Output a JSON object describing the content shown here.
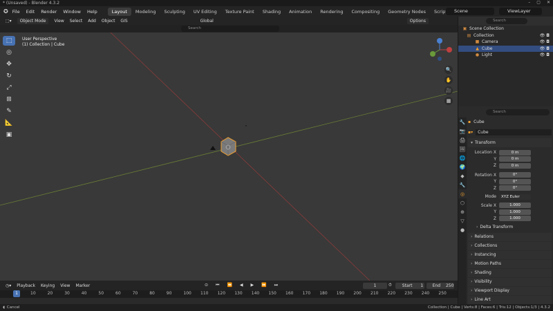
{
  "window": {
    "title": "* (Unsaved) - Blender 4.3.2",
    "buttons": [
      "–",
      "▢",
      "✕"
    ]
  },
  "menu": [
    "File",
    "Edit",
    "Render",
    "Window",
    "Help"
  ],
  "tabs": [
    "Layout",
    "Modeling",
    "Sculpting",
    "UV Editing",
    "Texture Paint",
    "Shading",
    "Animation",
    "Rendering",
    "Compositing",
    "Geometry Nodes",
    "Scripting"
  ],
  "active_tab": "Layout",
  "add_tab": "+",
  "scene": "Scene",
  "view_layer": "ViewLayer",
  "viewport_header": {
    "mode": "Object Mode",
    "menus": [
      "View",
      "Select",
      "Add",
      "Object",
      "GIS"
    ],
    "transform": "Global",
    "options": "Options"
  },
  "search": {
    "placeholder": "Search"
  },
  "viewport_info": {
    "line1": "User Perspective",
    "line2": "(1) Collection | Cube"
  },
  "outliner": {
    "search_placeholder": "Search",
    "rows": [
      {
        "label": "Scene Collection",
        "icon": "▣",
        "sel": false,
        "indent": 6
      },
      {
        "label": "Collection",
        "icon": "▤",
        "sel": false,
        "indent": 12
      },
      {
        "label": "Camera",
        "icon": "■",
        "sel": false,
        "indent": 24
      },
      {
        "label": "Cube",
        "icon": "▲",
        "sel": true,
        "indent": 24
      },
      {
        "label": "Light",
        "icon": "●",
        "sel": false,
        "indent": 24
      }
    ]
  },
  "properties": {
    "object_name": "Cube",
    "data_name": "Cube",
    "transform_label": "Transform",
    "location": {
      "label": "Location X",
      "x": "0 m",
      "y": "0 m",
      "z": "0 m"
    },
    "rotation": {
      "label": "Rotation X",
      "x": "0°",
      "y": "0°",
      "z": "0°"
    },
    "mode": {
      "label": "Mode",
      "value": "XYZ Euler"
    },
    "scale": {
      "label": "Scale X",
      "x": "1.000",
      "y": "1.000",
      "z": "1.000"
    },
    "axis_y": "Y",
    "axis_z": "Z",
    "delta": "Delta Transform",
    "sections": [
      "Relations",
      "Collections",
      "Instancing",
      "Motion Paths",
      "Shading",
      "Visibility",
      "Viewport Display",
      "Line Art"
    ]
  },
  "timeline": {
    "menus": [
      "Playback",
      "Keying",
      "View",
      "Marker"
    ],
    "current": "1",
    "start_label": "Start",
    "start": "1",
    "end_label": "End",
    "end": "250",
    "ticks": [
      "1",
      "10",
      "20",
      "30",
      "40",
      "50",
      "60",
      "70",
      "80",
      "90",
      "100",
      "110",
      "120",
      "130",
      "140",
      "150",
      "160",
      "170",
      "180",
      "190",
      "200",
      "210",
      "220",
      "230",
      "240",
      "250"
    ]
  },
  "status": {
    "left": "Cancel",
    "right": "Collection | Cube | Verts:8 | Faces:6 | Tris:12 | Objects:1/3 | 4.3.2"
  },
  "colors": {
    "x_axis": "#a53a3a",
    "y_axis": "#6e8a2f",
    "accent": "#4772b3",
    "select": "#f0a030"
  }
}
